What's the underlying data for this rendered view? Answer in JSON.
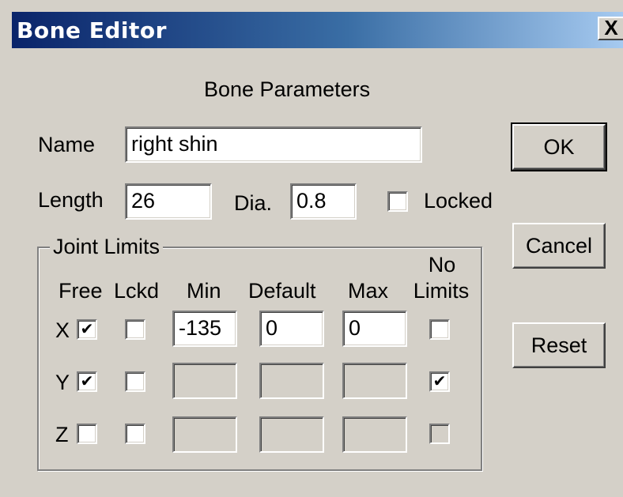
{
  "window": {
    "title": "Bone Editor",
    "close_glyph": "X"
  },
  "heading": "Bone Parameters",
  "name": {
    "label": "Name",
    "value": "right shin"
  },
  "length": {
    "label": "Length",
    "value": "26"
  },
  "dia": {
    "label": "Dia.",
    "value": "0.8"
  },
  "locked": {
    "label": "Locked",
    "checked": false
  },
  "buttons": {
    "ok": "OK",
    "cancel": "Cancel",
    "reset": "Reset"
  },
  "joint_limits": {
    "title": "Joint Limits",
    "columns": {
      "free": "Free",
      "lckd": "Lckd",
      "min": "Min",
      "default": "Default",
      "max": "Max",
      "no_limits_1": "No",
      "no_limits_2": "Limits"
    },
    "rows": [
      {
        "axis": "X",
        "free": true,
        "lckd": false,
        "min": "-135",
        "default": "0",
        "max": "0",
        "no_limits": false
      },
      {
        "axis": "Y",
        "free": true,
        "lckd": false,
        "min": "",
        "default": "",
        "max": "",
        "no_limits": true
      },
      {
        "axis": "Z",
        "free": false,
        "lckd": false,
        "min": "",
        "default": "",
        "max": "",
        "no_limits": false
      }
    ]
  },
  "check_glyph": "✔"
}
